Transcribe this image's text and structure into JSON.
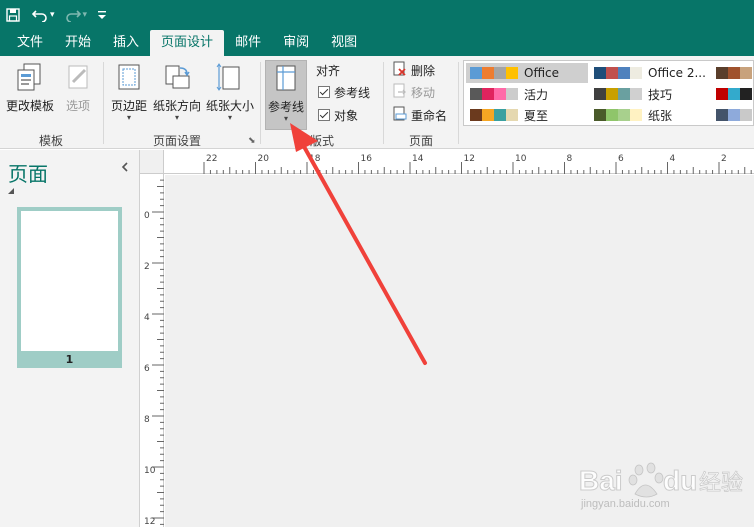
{
  "quick_access": {
    "save_icon": "save-icon",
    "undo_icon": "undo-icon",
    "redo_icon": "redo-icon",
    "customize_icon": "customize-qat-icon"
  },
  "tabs": [
    {
      "label": "文件"
    },
    {
      "label": "开始"
    },
    {
      "label": "插入"
    },
    {
      "label": "页面设计",
      "active": true
    },
    {
      "label": "邮件"
    },
    {
      "label": "审阅"
    },
    {
      "label": "视图"
    }
  ],
  "ribbon": {
    "template_group": {
      "label": "模板",
      "change_template": "更改模板",
      "options": "选项"
    },
    "page_setup_group": {
      "label": "页面设置",
      "margins": "页边距",
      "orientation": "纸张方向",
      "size": "纸张大小"
    },
    "layout_group": {
      "label": "版式",
      "guides": "参考线",
      "align": "对齐",
      "align_guides": "参考线",
      "align_objects": "对象"
    },
    "pages_group": {
      "label": "页面",
      "delete": "删除",
      "move": "移动",
      "rename": "重命名"
    },
    "schemes": [
      {
        "name": "Office",
        "colors": [
          "#5b9bd5",
          "#ed7d31",
          "#a5a5a5",
          "#ffc000"
        ],
        "selected": true
      },
      {
        "name": "Office 2...",
        "colors": [
          "#1f4e79",
          "#c0504d",
          "#4f81bd",
          "#eeece1"
        ]
      },
      {
        "name": "",
        "colors": [
          "#5a3e2b",
          "#a0522d",
          "#c8a27c"
        ]
      },
      {
        "name": "活力",
        "colors": [
          "#595959",
          "#e0245e",
          "#ff6aa8",
          "#cccccc"
        ]
      },
      {
        "name": "技巧",
        "colors": [
          "#404040",
          "#c8a000",
          "#6aa0a0",
          "#d0d0d0"
        ]
      },
      {
        "name": "",
        "colors": [
          "#c00000",
          "#33aacc",
          "#222222"
        ]
      },
      {
        "name": "夏至",
        "colors": [
          "#6b3a1e",
          "#f5a623",
          "#3aa0a0",
          "#e5d8b0"
        ]
      },
      {
        "name": "纸张",
        "colors": [
          "#4a5a2a",
          "#8fc56a",
          "#a8d08d",
          "#fff2c2"
        ]
      },
      {
        "name": "",
        "colors": [
          "#44546a",
          "#8eaadb",
          "#c9c9c9"
        ]
      }
    ]
  },
  "left_pane": {
    "title": "页面",
    "collapse_icon": "chevron-left-icon",
    "page_number": "1"
  },
  "ruler": {
    "horizontal_labels": [
      "22",
      "20",
      "18",
      "16",
      "14",
      "12",
      "10",
      "8",
      "6",
      "4",
      "2"
    ],
    "vertical_labels": [
      "0",
      "2",
      "4",
      "6",
      "8",
      "10",
      "12"
    ]
  },
  "watermark": {
    "brand": "Bai du 经验",
    "url": "jingyan.baidu.com"
  },
  "colors": {
    "accent": "#077568",
    "annotation_arrow": "#f0413a"
  }
}
